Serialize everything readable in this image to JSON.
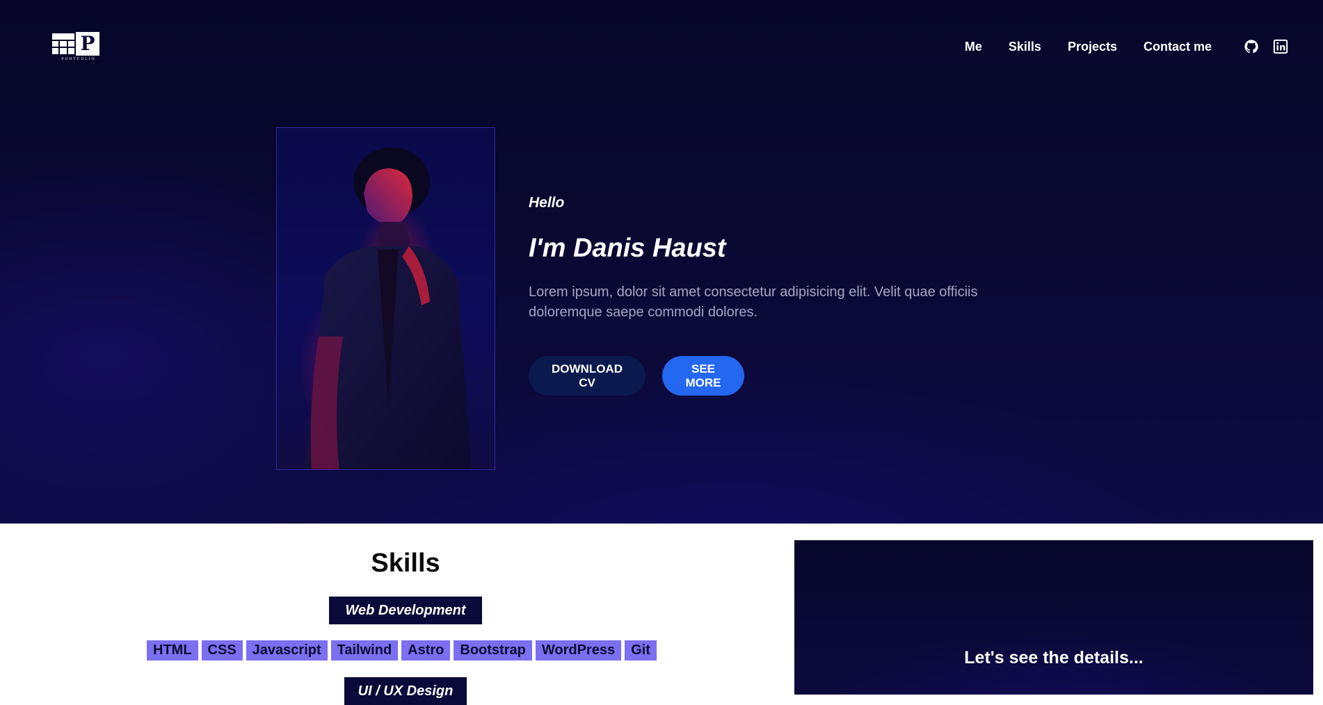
{
  "header": {
    "logo_letter": "P",
    "logo_text": "PORTFOLIO",
    "nav": [
      {
        "label": "Me"
      },
      {
        "label": "Skills"
      },
      {
        "label": "Projects"
      },
      {
        "label": "Contact me"
      }
    ],
    "social_icons": [
      "github-icon",
      "linkedin-icon"
    ]
  },
  "hero": {
    "greeting": "Hello",
    "name": "I'm Danis Haust",
    "description": "Lorem ipsum, dolor sit amet consectetur adipisicing elit. Velit quae officiis doloremque saepe commodi dolores.",
    "download_label": "DOWNLOAD CV",
    "more_label": "SEE MORE"
  },
  "skills": {
    "title": "Skills",
    "categories": [
      {
        "name": "Web Development",
        "tags": [
          "HTML",
          "CSS",
          "Javascript",
          "Tailwind",
          "Astro",
          "Bootstrap",
          "WordPress",
          "Git"
        ]
      },
      {
        "name": "UI / UX Design"
      }
    ]
  },
  "details": {
    "text": "Let's see the details..."
  },
  "colors": {
    "hero_bg": "#0a0830",
    "accent_blue": "#2467f0",
    "dark_button": "#0b1a4e",
    "tag_bg": "#7b6ff2",
    "category_bg": "#0a0a3a"
  }
}
